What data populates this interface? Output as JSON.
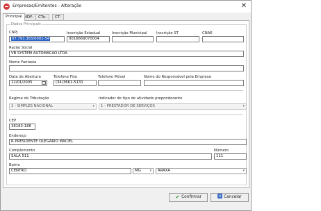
{
  "window": {
    "title": "Empresas/Emitentes - Alteração"
  },
  "tabs": [
    "Principal",
    "MDF-e",
    "CTe-Os",
    "CT-e"
  ],
  "group": {
    "title": "Dados Principais"
  },
  "fields": {
    "cnpj": {
      "label": "CNPJ",
      "value": "07.793.365/0001-54"
    },
    "inscricao_estadual": {
      "label": "Inscrição Estadual",
      "value": "0016669070004"
    },
    "inscricao_municipal": {
      "label": "Inscrição Municipal",
      "value": ""
    },
    "inscricao_st": {
      "label": "Inscrição ST",
      "value": ""
    },
    "cnae": {
      "label": "CNAE",
      "value": ""
    },
    "razao_social": {
      "label": "Razão Social",
      "value": "VB SYSTEM AUTOMACAO LTDA"
    },
    "nome_fantasia": {
      "label": "Nome Fantasia",
      "value": ""
    },
    "data_abertura": {
      "label": "Data de Abertura",
      "value": "12/01/2005"
    },
    "telefone_fixo": {
      "label": "Telefone Fixo",
      "value": "(34)3661-5131"
    },
    "telefone_movel": {
      "label": "Telefone Móvel",
      "value": ""
    },
    "responsavel": {
      "label": "Nome do Responsável pela Empresa",
      "value": ""
    },
    "regime_tributacao": {
      "label": "Regime de Tributação",
      "value": "1 - SIMPLES NACIONAL"
    },
    "indicador_atividade": {
      "label": "Indicador de tipo de atividade preponderante",
      "value": "1 - PRESTADOR DE SERVIÇOS"
    },
    "cep": {
      "label": "CEP",
      "value": "38183-186"
    },
    "endereco": {
      "label": "Endereço",
      "value": "R PRESIDENTE OLEGARIO MACIEL"
    },
    "complemento": {
      "label": "Complemento",
      "value": "SALA 511"
    },
    "numero": {
      "label": "Número",
      "value": "111"
    },
    "bairro": {
      "label": "Bairro",
      "value": "CENTRO"
    },
    "uf": {
      "value": "MG"
    },
    "cidade": {
      "value": "ARAXA"
    }
  },
  "buttons": {
    "confirm": "Confirmar",
    "cancel": "Cancelar"
  },
  "colors": {
    "selection": "#2a64c8",
    "confirm_icon": "#2f8f2f",
    "cancel_icon": "#3a6fc9",
    "app_icon": "#d43b3b"
  },
  "icons": {
    "app": "app-logo-icon",
    "close": "close-icon",
    "calendar": "calendar-icon",
    "confirm": "check-icon",
    "cancel": "cancel-icon"
  }
}
